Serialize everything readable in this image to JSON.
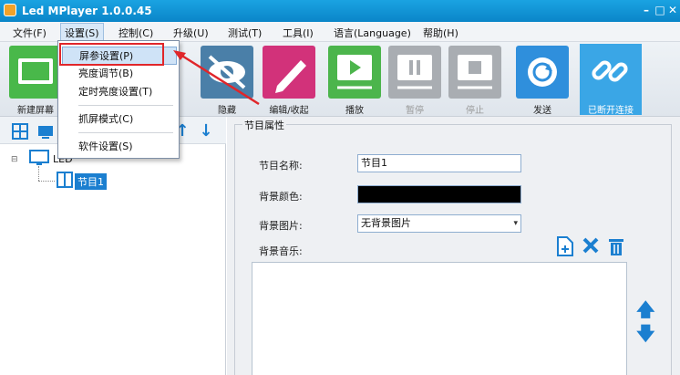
{
  "window": {
    "title": "Led MPlayer 1.0.0.45",
    "minimize": "–",
    "maximize": "□",
    "close": "✕"
  },
  "menu": [
    "文件(F)",
    "设置(S)",
    "控制(C)",
    "升级(U)",
    "测试(T)",
    "工具(I)",
    "语言(Language)",
    "帮助(H)"
  ],
  "settings_menu": [
    "屏参设置(P)",
    "亮度调节(B)",
    "定时亮度设置(T)",
    "抓屏模式(C)",
    "软件设置(S)"
  ],
  "toolbar": {
    "new_screen": "新建屏幕",
    "hide": "隐藏",
    "edit_collapse": "编辑/收起",
    "play": "播放",
    "pause": "暂停",
    "stop": "停止",
    "send": "发送",
    "disconnected": "已断开连接"
  },
  "tree": {
    "root": "LED",
    "program": "节目1"
  },
  "properties": {
    "group_title": "节目属性",
    "name_label": "节目名称:",
    "name_value": "节目1",
    "bg_color_label": "背景颜色:",
    "bg_image_label": "背景图片:",
    "bg_image_value": "无背景图片",
    "bg_music_label": "背景音乐:"
  },
  "colors": {
    "titlebar": "#0a85c8",
    "accent": "#1b7fd0",
    "highlight_border": "#e0262a",
    "bg_color_value": "#000000"
  }
}
